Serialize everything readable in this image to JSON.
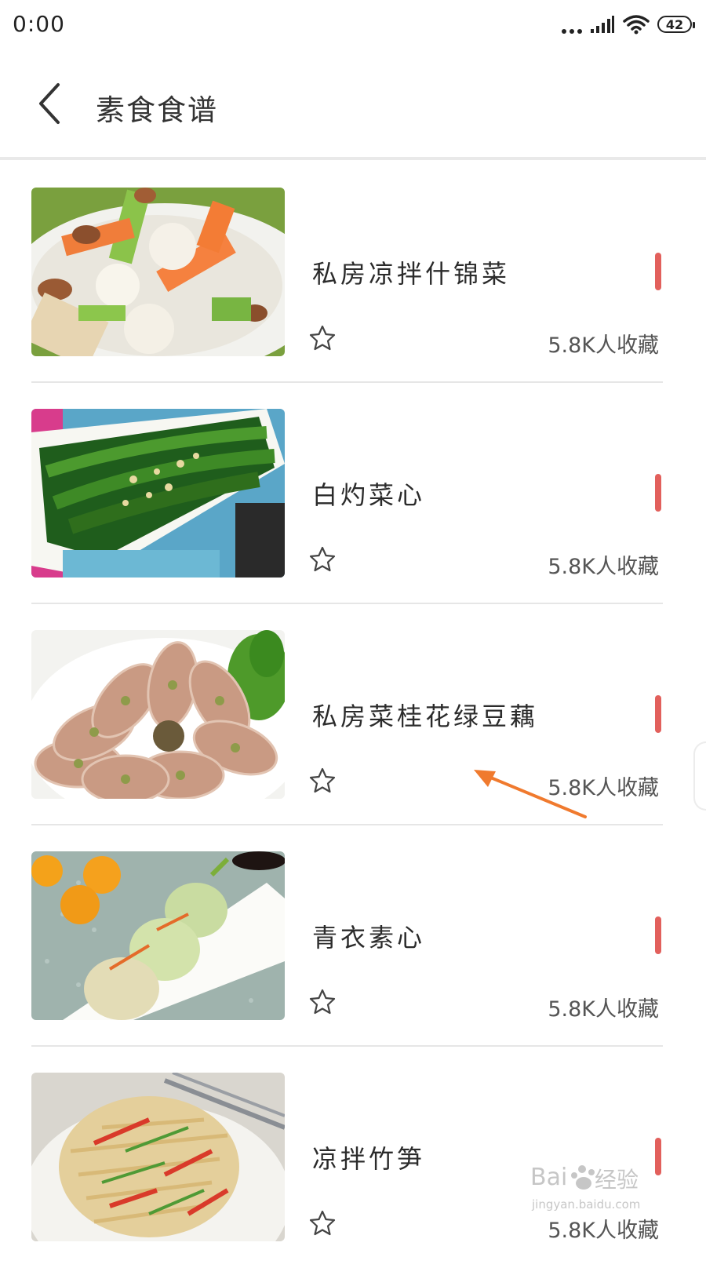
{
  "status_bar": {
    "time": "0:00",
    "battery": "42",
    "icons": [
      "more-dots-icon",
      "signal-icon",
      "wifi-icon",
      "battery-icon"
    ]
  },
  "header": {
    "title": "素食食谱",
    "back_icon": "chevron-left-icon"
  },
  "recipes": [
    {
      "title": "私房凉拌什锦菜",
      "favorites": "5.8K人收藏"
    },
    {
      "title": "白灼菜心",
      "favorites": "5.8K人收藏"
    },
    {
      "title": "私房菜桂花绿豆藕",
      "favorites": "5.8K人收藏"
    },
    {
      "title": "青衣素心",
      "favorites": "5.8K人收藏"
    },
    {
      "title": "凉拌竹笋",
      "favorites": "5.8K人收藏"
    }
  ],
  "colors": {
    "accent_bar": "#e2605c",
    "annotation_arrow": "#f07a2e",
    "divider": "#e6e6e6"
  },
  "watermark": {
    "text": "经验",
    "brand": "Bai",
    "url": "jingyan.baidu.com"
  }
}
